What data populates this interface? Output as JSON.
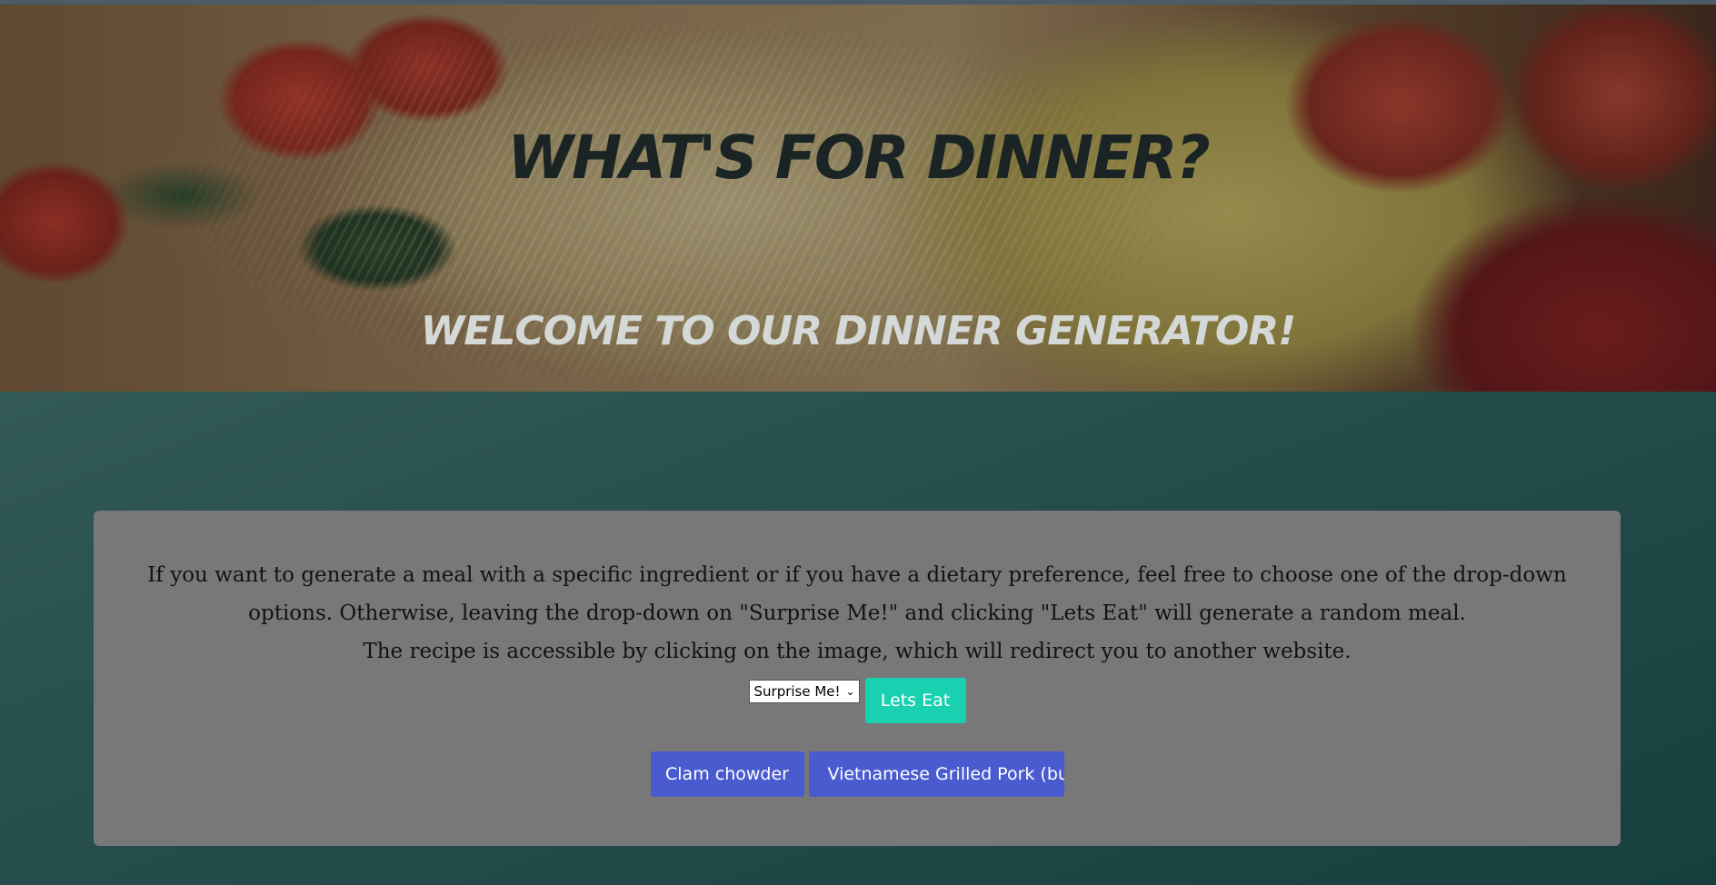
{
  "hero": {
    "title": "WHAT'S FOR DINNER?",
    "subtitle": "WELCOME TO OUR DINNER GENERATOR!"
  },
  "info": {
    "line1": "If you want to generate a meal with a specific ingredient or if you have a dietary preference, feel free to choose one of the drop-down",
    "line2": "options. Otherwise, leaving the drop-down on \"Surprise Me!\" and clicking \"Lets Eat\" will generate a random meal.",
    "line3": "The recipe is accessible by clicking on the image, which will redirect you to another website."
  },
  "controls": {
    "dropdown_selected": "Surprise Me!",
    "submit_label": "Lets Eat"
  },
  "meals": [
    "Clam chowder",
    "Vietnamese Grilled Pork (bun"
  ],
  "colors": {
    "card_bg": "#787878",
    "lets_eat_bg": "#19d0b0",
    "meal_button_bg": "#4a5bd0",
    "page_bg": "#2a5250"
  },
  "icons": {
    "dropdown": "chevron-down-icon"
  }
}
